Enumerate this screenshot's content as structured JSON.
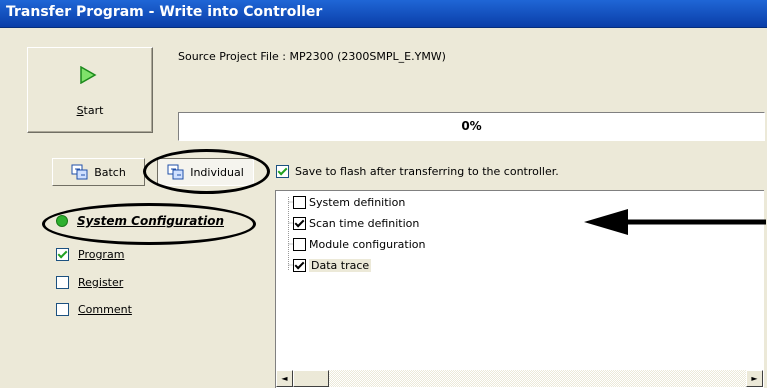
{
  "window": {
    "title": "Transfer Program - Write into Controller"
  },
  "start": {
    "label_prefix": "",
    "label_underlined": "S",
    "label_rest": "tart",
    "icon": "play-triangle-icon"
  },
  "source": {
    "label": "Source Project File : MP2300    (2300SMPL_E.YMW)"
  },
  "progress": {
    "value": 0,
    "label": "0%"
  },
  "transfer_mode": {
    "batch_label": "Batch",
    "individual_label": "Individual",
    "selected": "Individual"
  },
  "save_flash": {
    "checked": true,
    "label": "Save to flash after transferring to the controller."
  },
  "left_items": [
    {
      "label": "System Configuration",
      "checked": true,
      "active": true
    },
    {
      "label": "Program",
      "checked": true,
      "active": false
    },
    {
      "label": "Register",
      "checked": false,
      "active": false
    },
    {
      "label": "Comment",
      "checked": false,
      "active": false
    }
  ],
  "tree_items": [
    {
      "label": "System definition",
      "checked": false
    },
    {
      "label": "Scan time definition",
      "checked": true
    },
    {
      "label": "Module configuration",
      "checked": false
    },
    {
      "label": "Data trace",
      "checked": true
    }
  ],
  "scrollbar": {
    "left_arrow": "◄",
    "right_arrow": "►"
  },
  "colors": {
    "title_bar": "#0a3ea8",
    "check_green": "#21a121",
    "dialog_bg": "#ece9d8"
  }
}
